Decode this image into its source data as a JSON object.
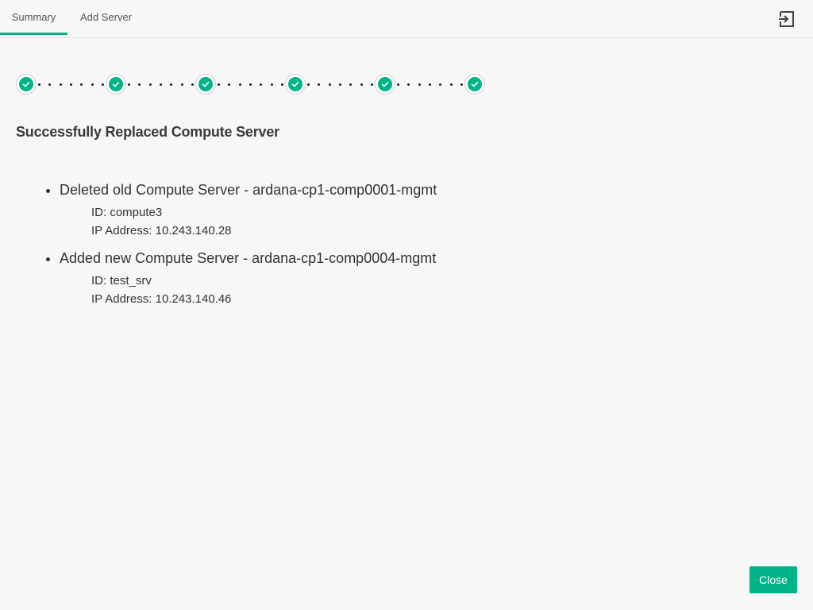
{
  "tabs": [
    {
      "label": "Summary",
      "active": true
    },
    {
      "label": "Add Server",
      "active": false
    }
  ],
  "header": {
    "logout_icon": "logout-icon"
  },
  "stepper": {
    "steps": [
      {
        "status": "complete"
      },
      {
        "status": "complete"
      },
      {
        "status": "complete"
      },
      {
        "status": "complete"
      },
      {
        "status": "complete"
      },
      {
        "status": "complete"
      }
    ],
    "accent_color": "#00b388"
  },
  "main": {
    "heading": "Successfully Replaced Compute Server",
    "items": [
      {
        "title": "Deleted old Compute Server - ardana-cp1-comp0001-mgmt",
        "id_line": "ID: compute3",
        "ip_line": "IP Address: 10.243.140.28"
      },
      {
        "title": "Added new Compute Server - ardana-cp1-comp0004-mgmt",
        "id_line": "ID: test_srv",
        "ip_line": "IP Address: 10.243.140.46"
      }
    ]
  },
  "footer": {
    "close_label": "Close"
  }
}
